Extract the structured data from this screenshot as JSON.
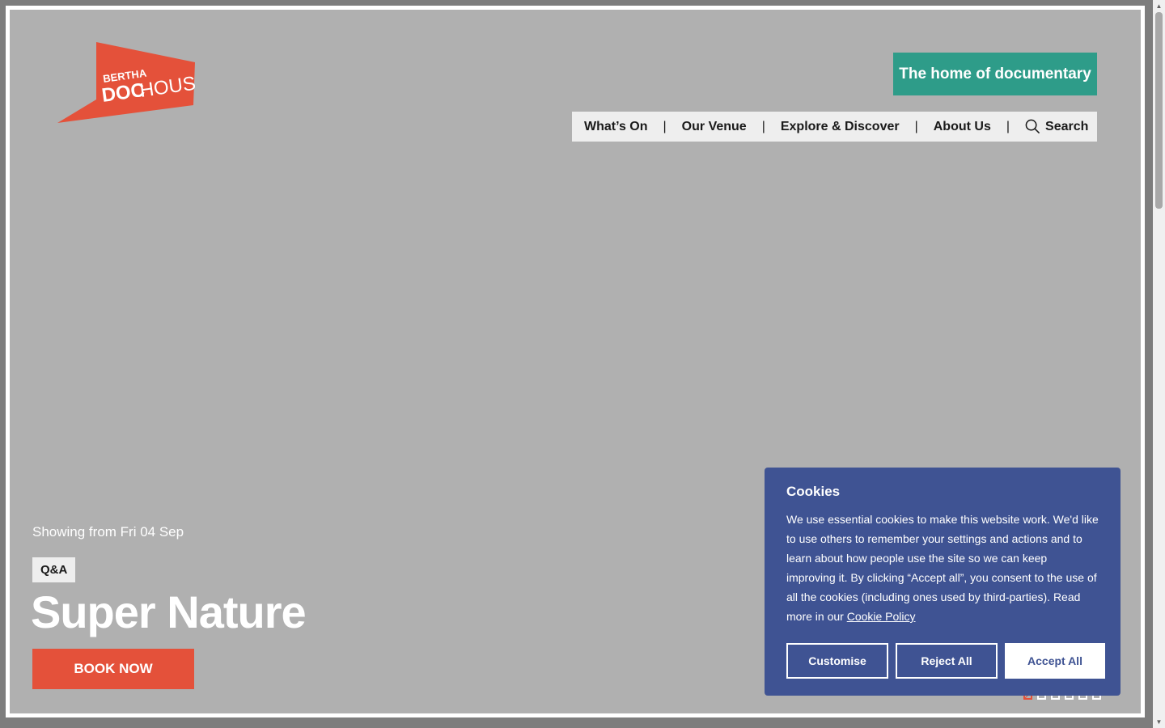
{
  "header": {
    "tagline": "The home of documentary",
    "nav": [
      {
        "label": "What’s On"
      },
      {
        "label": "Our Venue"
      },
      {
        "label": "Explore & Discover"
      },
      {
        "label": "About Us"
      }
    ],
    "separator": "|",
    "search_label": "Search",
    "logo_text": [
      "BERTHA",
      "DOC",
      "HOUSE"
    ],
    "logo_color": "#e4513a"
  },
  "hero": {
    "showing": "Showing from Fri 04 Sep",
    "badge": "Q&A",
    "title": "Super Nature",
    "cta": "BOOK NOW",
    "slides_total": 6,
    "slide_active": 1
  },
  "cookies": {
    "title": "Cookies",
    "body": "We use essential cookies to make this website work. We'd like to use others to remember your settings and actions and to learn about how people use the site so we can keep improving it. By clicking “Accept all”, you consent to the use of all the cookies (including ones used by third-parties). Read more in our",
    "link": "Cookie Policy",
    "customise": "Customise",
    "reject": "Reject All",
    "accept": "Accept All"
  },
  "colors": {
    "accent_orange": "#e4513a",
    "tagline_teal": "#2e9c89",
    "cookie_blue": "#3f5393"
  }
}
